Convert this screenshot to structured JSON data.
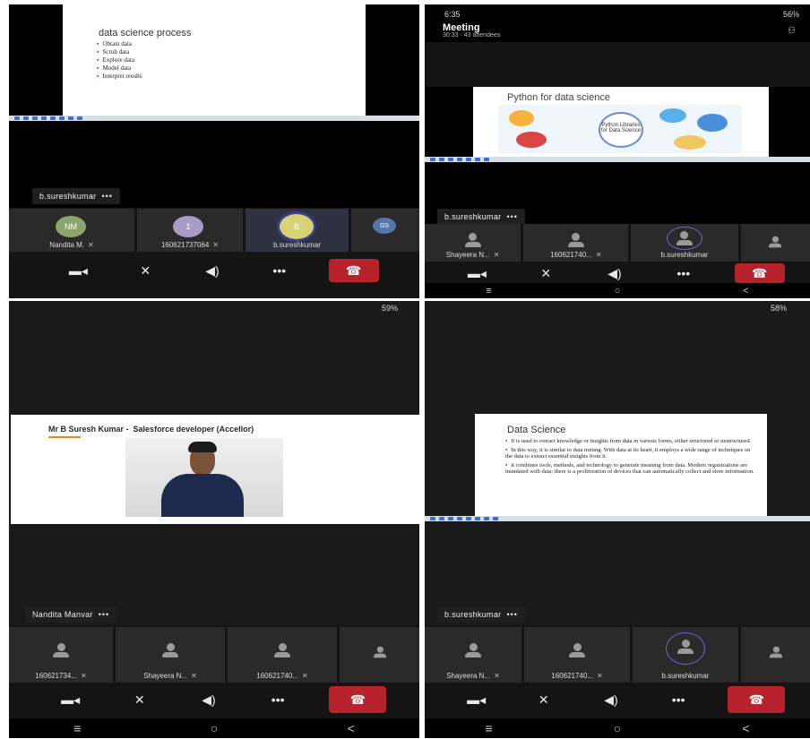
{
  "q1": {
    "slide_title": "data science process",
    "bullets": [
      "Obtain data",
      "Scrub data",
      "Explore data",
      "Model data",
      "Interpret results"
    ],
    "presenter_chip": "b.sureshkumar",
    "more": "•••",
    "tiles": [
      {
        "initials": "NM",
        "label": "Nandita M.",
        "color": "#8ca56a"
      },
      {
        "initials": "1",
        "label": "160621737064",
        "color": "#a89cc7"
      },
      {
        "initials": "B",
        "label": "b.sureshkumar",
        "color": "#d8d277"
      },
      {
        "initials": "GS",
        "label": "",
        "color": "#5577a8"
      }
    ]
  },
  "q2": {
    "time": "6:35",
    "battery": "56%",
    "meeting_title": "Meeting",
    "meeting_sub": "30:33 · 43 attendees",
    "slide_title": "Python for data science",
    "center_text": "Python Libraries for Data Science",
    "presenter_chip": "b.sureshkumar",
    "more": "•••",
    "tiles": [
      {
        "label": "Shayeera N..."
      },
      {
        "label": "160621740..."
      },
      {
        "label": "b.sureshkumar"
      },
      {
        "label": ""
      }
    ]
  },
  "q3": {
    "battery": "59%",
    "slide_title_name": "Mr B Suresh Kumar -",
    "slide_title_role": "Salesforce developer (Accellor)",
    "presenter_chip": "Nandita Manvar",
    "more": "•••",
    "tiles": [
      {
        "label": "160621734..."
      },
      {
        "label": "Shayeera N..."
      },
      {
        "label": "160621740..."
      },
      {
        "label": ""
      }
    ]
  },
  "q4": {
    "battery": "58%",
    "slide_title": "Data Science",
    "bullets": [
      "It is used to extract knowledge or insights from data in various forms, either structured or unstructured.",
      "In this way, it is similar to data mining. With data at its heart, it employs a wide range of techniques on the data to extract essential insights from it.",
      "it combines tools, methods, and technology to generate meaning from data. Modern organizations are inundated with data; there is a proliferation of devices that can automatically collect and store information."
    ],
    "presenter_chip": "b.sureshkumar",
    "more": "•••",
    "tiles": [
      {
        "label": "Shayeera N..."
      },
      {
        "label": "160621740..."
      },
      {
        "label": "b.sureshkumar"
      },
      {
        "label": ""
      }
    ]
  },
  "controls": {
    "more": "•••"
  },
  "nav": {
    "back": "<"
  }
}
